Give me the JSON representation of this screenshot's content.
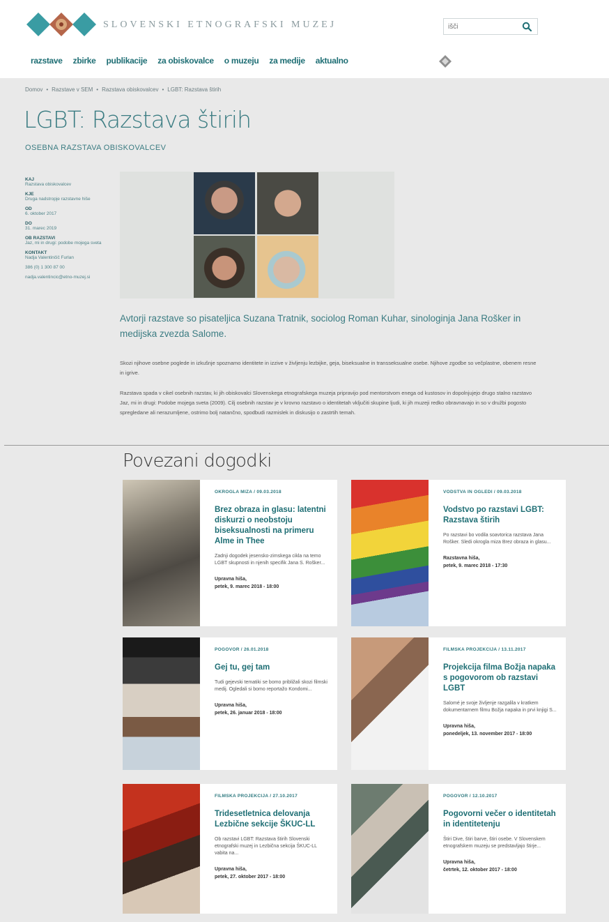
{
  "header": {
    "site_name": "SLOVENSKI ETNOGRAFSKI MUZEJ",
    "search_placeholder": "išči",
    "brand_color": "#3a9ca3"
  },
  "nav": {
    "items": [
      "razstave",
      "zbirke",
      "publikacije",
      "za obiskovalce",
      "o muzeju",
      "za medije",
      "aktualno"
    ]
  },
  "breadcrumb": [
    "Domov",
    "Razstave v SEM",
    "Razstava obiskovalcev",
    "LGBT: Razstava štirih"
  ],
  "page": {
    "title": "LGBT: Razstava štirih",
    "subtitle": "OSEBNA RAZSTAVA OBISKOVALCEV"
  },
  "sidebar": [
    {
      "label": "KAJ",
      "value": "Razstava obiskovalcev"
    },
    {
      "label": "KJE",
      "value": "Druga nadstropje razstavne hiše"
    },
    {
      "label": "OD",
      "value": "6. oktober 2017"
    },
    {
      "label": "DO",
      "value": "31. marec 2019"
    },
    {
      "label": "OB RAZSTAVI",
      "value": "Jaz, mi in drugi: podobe mojega sveta"
    },
    {
      "label": "KONTAKT",
      "value": "Nadja Valentinčič Furlan"
    },
    {
      "label": "",
      "value": "386 (0) 1 300 87 00"
    },
    {
      "label": "",
      "value": "nadja.valentincic@etno-muzej.si"
    }
  ],
  "intro": {
    "lead": "Avtorji razstave so pisateljica Suzana Tratnik, sociolog Roman Kuhar, sinologinja Jana Rošker in medijska zvezda Salome.",
    "p1": "Skozi njihove osebne poglede in izkušnje spoznamo identitete in izzive v življenju lezbijke, geja, biseksualne in transseksualne osebe. Njihove zgodbe so večplastne, obenem resne in igrive.",
    "p2": "Razstava spada v cikel osebnih razstav, ki jih obiskovalci Slovenskega etnografskega muzeja pripravijo pod mentorstvom enega od kustosov in dopolnjujejo drugo stalno razstavo Jaz, mi in drugi: Podobe mojega sveta (2009). Cilj osebnih razstav je v krovno razstavo o identitetah vključiti skupine ljudi, ki jih muzeji redko obravnavajo in so v družbi pogosto spregledane ali nerazumljene, ostrimo bolj natančno, spodbudi razmislek in diskusijo o zastrtih temah."
  },
  "events": {
    "section_title": "Povezani dogodki",
    "items": [
      {
        "category": "OKROGLA MIZA / 09.03.2018",
        "title": "Brez obraza in glasu: latentni diskurzi o neobstoju biseksualnosti na primeru Alme in Thee",
        "desc": "Zadnji dogodek jesensko-zimskega cikla na temo LGBT skupnosti in njenih specifik Jana S. Rošker...",
        "location": "Upravna hiša,",
        "date": "petek, 9. marec 2018 - 18:00"
      },
      {
        "category": "VODSTVA IN OGLEDI / 09.03.2018",
        "title": "Vodstvo po razstavi LGBT: Razstava štirih",
        "desc": "Po razstavi bo vodila soavtorica razstava Jana Rošker. Sledi okrogla miza Brez obraza in glasu...",
        "location": "Razstavna hiša,",
        "date": "petek, 9. marec 2018 - 17:30"
      },
      {
        "category": "POGOVOR / 26.01.2018",
        "title": "Gej tu, gej tam",
        "desc": "Tudi gejevski tematiki se bomo približali skozi filmski medij. Ogledali si bomo reportažo Kondomi...",
        "location": "Upravna hiša,",
        "date": "petek, 26. januar 2018 - 18:00"
      },
      {
        "category": "FILMSKA PROJEKCIJA / 13.11.2017",
        "title": "Projekcija filma Božja napaka s pogovorom ob razstavi LGBT",
        "desc": "Salomé je svoje življenje razgalila v kratkem dokumentarnem filmu Božja napaka in prvi knjigi S...",
        "location": "Upravna hiša,",
        "date": "ponedeljek, 13. november 2017 - 18:00"
      },
      {
        "category": "FILMSKA PROJEKCIJA / 27.10.2017",
        "title": "Tridesetletnica delovanja Lezbične sekcije ŠKUC-LL",
        "desc": "Ob razstavi LGBT: Razstava štirih Slovenski etnografski muzej in Lezbična sekcija ŠKUC-LL vabita na...",
        "location": "Upravna hiša,",
        "date": "petek, 27. oktober 2017 - 18:00"
      },
      {
        "category": "POGOVOR / 12.10.2017",
        "title": "Pogovorni večer o identitetah in identitetenju",
        "desc": "Štiri Dive, štiri barve, štiri osebe. V Slovenskem etnografskem muzeju se predstavljajo štirje...",
        "location": "Upravna hiša,",
        "date": "četrtek, 12. oktober 2017 - 18:00"
      }
    ]
  }
}
